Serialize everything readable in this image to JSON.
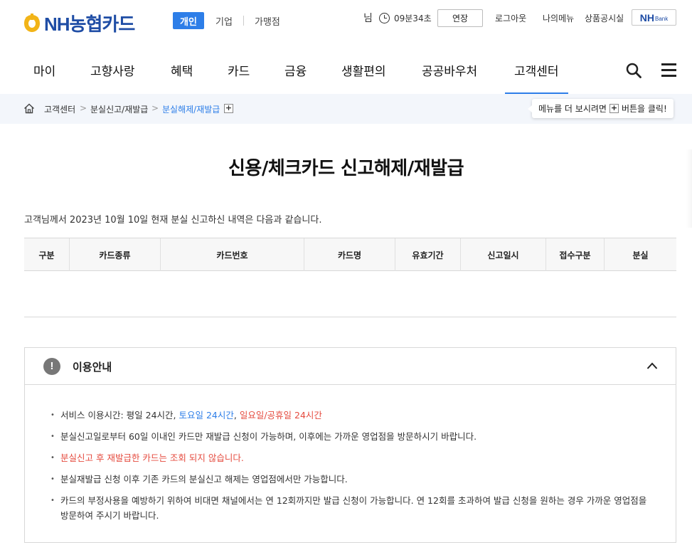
{
  "header": {
    "logo_text": "NH농협카드",
    "segments": {
      "personal": "개인",
      "corporate": "기업",
      "merchant": "가맹점"
    },
    "user_suffix": "님",
    "session_time": "09분34초",
    "extend_label": "연장",
    "logout_label": "로그아웃",
    "mymenu_label": "나의메뉴",
    "notice_label": "상품공시실",
    "nhbank": {
      "main": "NH",
      "sub": "Bank"
    }
  },
  "nav": {
    "items": [
      "마이",
      "고향사랑",
      "혜택",
      "카드",
      "금융",
      "생활편의",
      "공공바우처",
      "고객센터"
    ],
    "active_index": 7
  },
  "breadcrumb": {
    "items": [
      "고객센터",
      "분실신고/재발급",
      "분실해제/재발급"
    ],
    "separator": ">",
    "plus": "+",
    "tip_before": "메뉴를 더 보시려면",
    "tip_after": "버튼을 클릭!"
  },
  "page": {
    "title": "신용/체크카드 신고해제/재발급",
    "summary": "고객님께서 2023년 10월 10일 현재 분실 신고하신 내역은 다음과 같습니다."
  },
  "table": {
    "columns": [
      "구분",
      "카드종류",
      "카드번호",
      "카드명",
      "유효기간",
      "신고일시",
      "접수구분",
      "분실"
    ],
    "rows": []
  },
  "info": {
    "title": "이용안내",
    "item1_prefix": "서비스 이용시간: 평일 24시간, ",
    "item1_blue": "토요일 24시간",
    "item1_comma": ", ",
    "item1_red": "일요일/공휴일 24시간",
    "item2": "분실신고일로부터 60일 이내인 카드만 재발급 신청이 가능하며, 이후에는 가까운 영업점을 방문하시기 바랍니다.",
    "item3": "분실신고 후 재발급한 카드는 조회 되지 않습니다.",
    "item4": "분실재발급 신청 이후 기존 카드의 분실신고 해제는 영업점에서만 가능합니다.",
    "item5": "카드의 부정사용을 예방하기 위하여 비대면 채널에서는 연 12회까지만 발급 신청이 가능합니다. 연 12회를 초과하여 발급 신청을 원하는 경우 가까운 영업점을 방문하여 주시기 바랍니다."
  },
  "colors": {
    "brand": "#1f4da5",
    "accent": "#2d7ee8",
    "alert": "#e54b3f"
  },
  "icons": [
    "nh-logo-icon",
    "clock-icon",
    "search-icon",
    "hamburger-menu-icon",
    "home-icon",
    "plus-icon",
    "warning-icon",
    "chevron-up-icon"
  ]
}
